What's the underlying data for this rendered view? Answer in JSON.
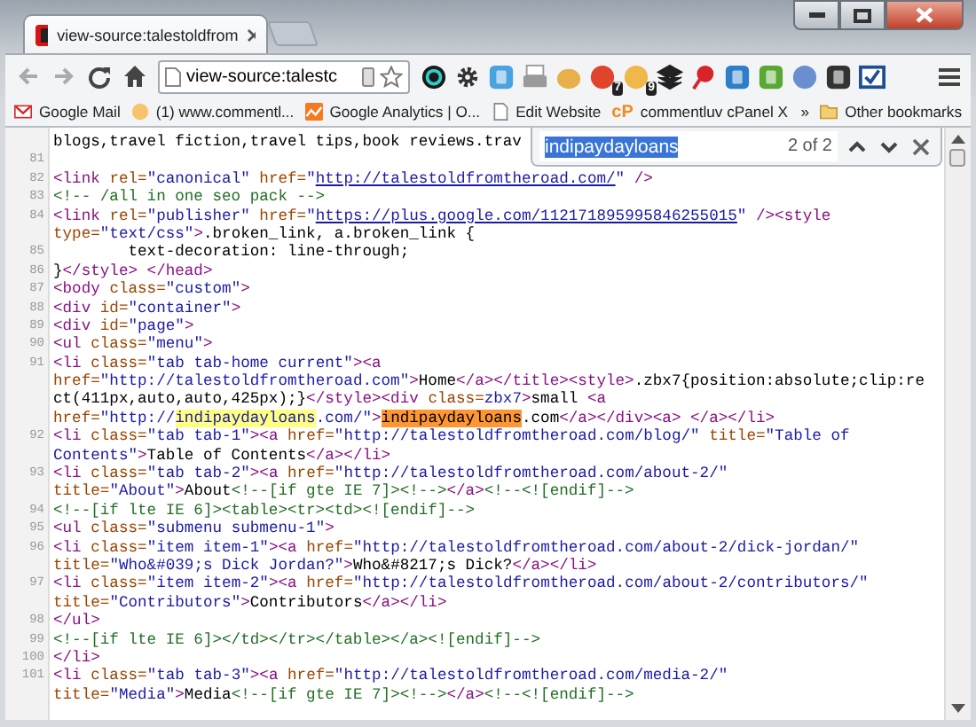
{
  "tabs": [
    {
      "title": "view-source:talestoldfrom",
      "selected": true
    }
  ],
  "toolbar": {
    "address": "view-source:talestc"
  },
  "extensions": [
    {
      "kind": "ring",
      "color": "#1a1a1a"
    },
    {
      "kind": "gear",
      "color": "#333333"
    },
    {
      "kind": "tile",
      "color": "#4aa3df"
    },
    {
      "kind": "printer",
      "color": "#9a9a9a"
    },
    {
      "kind": "blob",
      "color": "#e8b04a"
    },
    {
      "kind": "circle",
      "color": "#e0442c",
      "badge": "7"
    },
    {
      "kind": "circle",
      "color": "#f0b84a",
      "badge": "9"
    },
    {
      "kind": "layers",
      "color": "#222222"
    },
    {
      "kind": "pin",
      "color": "#d8232a"
    },
    {
      "kind": "tile",
      "color": "#2f7fc8"
    },
    {
      "kind": "tile",
      "color": "#5aa832"
    },
    {
      "kind": "circle",
      "color": "#6a8fd0"
    },
    {
      "kind": "tile",
      "color": "#333333"
    },
    {
      "kind": "check",
      "color": "#1d4f91"
    }
  ],
  "bookmarks": [
    {
      "kind": "mail",
      "label": "Google Mail"
    },
    {
      "kind": "face",
      "label": "(1) www.commentl..."
    },
    {
      "kind": "chart",
      "label": "Google Analytics | O..."
    },
    {
      "kind": "page",
      "label": "Edit Website"
    },
    {
      "kind": "logo",
      "logo_text": "cP",
      "label": "commentluv cPanel X"
    },
    {
      "kind": "more",
      "label": "»"
    },
    {
      "kind": "folder",
      "label": "Other bookmarks"
    }
  ],
  "find_bar": {
    "query": "indipaydayloans",
    "count": "2 of 2"
  },
  "source_lines": [
    {
      "tokens": [
        {
          "kind": "text",
          "text": "blogs,travel fiction,travel tips,book reviews.trav"
        }
      ]
    },
    {
      "number": "81"
    },
    {
      "number": "82",
      "tokens": [
        {
          "kind": "tag",
          "text": "<link "
        },
        {
          "kind": "attr",
          "text": "rel="
        },
        {
          "kind": "value",
          "text": "\"canonical\""
        },
        {
          "kind": "attr",
          "text": " href="
        },
        {
          "kind": "value",
          "text": "\""
        },
        {
          "kind": "link",
          "text": "http://talestoldfromtheroad.com/"
        },
        {
          "kind": "value",
          "text": "\""
        },
        {
          "kind": "tag",
          "text": " />"
        }
      ]
    },
    {
      "number": "83",
      "tokens": [
        {
          "kind": "comment",
          "text": "<!-- /all in one seo pack -->"
        }
      ]
    },
    {
      "number": "84",
      "tokens": [
        {
          "kind": "tag",
          "text": "<link "
        },
        {
          "kind": "attr",
          "text": "rel="
        },
        {
          "kind": "value",
          "text": "\"publisher\""
        },
        {
          "kind": "attr",
          "text": " href="
        },
        {
          "kind": "value",
          "text": "\""
        },
        {
          "kind": "link",
          "text": "https://plus.google.com/112171895995846255015"
        },
        {
          "kind": "value",
          "text": "\""
        },
        {
          "kind": "tag",
          "text": " /><style"
        },
        {
          "kind": "wrap"
        },
        {
          "kind": "attr",
          "text": "type="
        },
        {
          "kind": "value",
          "text": "\"text/css\""
        },
        {
          "kind": "tag",
          "text": ">"
        },
        {
          "kind": "text",
          "text": ".broken_link, a.broken_link {"
        }
      ]
    },
    {
      "number": "85",
      "tokens": [
        {
          "kind": "text",
          "text": "        text-decoration: line-through;"
        }
      ]
    },
    {
      "number": "86",
      "tokens": [
        {
          "kind": "text",
          "text": "}"
        },
        {
          "kind": "tag",
          "text": "</style> </head>"
        }
      ]
    },
    {
      "number": "87",
      "tokens": [
        {
          "kind": "tag",
          "text": "<body "
        },
        {
          "kind": "attr",
          "text": "class="
        },
        {
          "kind": "value",
          "text": "\"custom\""
        },
        {
          "kind": "tag",
          "text": ">"
        }
      ]
    },
    {
      "number": "88",
      "tokens": [
        {
          "kind": "tag",
          "text": "<div "
        },
        {
          "kind": "attr",
          "text": "id="
        },
        {
          "kind": "value",
          "text": "\"container\""
        },
        {
          "kind": "tag",
          "text": ">"
        }
      ]
    },
    {
      "number": "89",
      "tokens": [
        {
          "kind": "tag",
          "text": "<div "
        },
        {
          "kind": "attr",
          "text": "id="
        },
        {
          "kind": "value",
          "text": "\"page\""
        },
        {
          "kind": "tag",
          "text": ">"
        }
      ]
    },
    {
      "number": "90",
      "tokens": [
        {
          "kind": "tag",
          "text": "<ul "
        },
        {
          "kind": "attr",
          "text": "class="
        },
        {
          "kind": "value",
          "text": "\"menu\""
        },
        {
          "kind": "tag",
          "text": ">"
        }
      ]
    },
    {
      "number": "91",
      "tokens": [
        {
          "kind": "tag",
          "text": "<li "
        },
        {
          "kind": "attr",
          "text": "class="
        },
        {
          "kind": "value",
          "text": "\"tab tab-home current\""
        },
        {
          "kind": "tag",
          "text": "><a"
        },
        {
          "kind": "wrap"
        },
        {
          "kind": "attr",
          "text": "href="
        },
        {
          "kind": "value",
          "text": "\"http://talestoldfromtheroad.com\""
        },
        {
          "kind": "tag",
          "text": ">"
        },
        {
          "kind": "text",
          "text": "Home"
        },
        {
          "kind": "tag",
          "text": "</a></title><style>"
        },
        {
          "kind": "text",
          "text": ".zbx7{position:absolute;clip:re"
        },
        {
          "kind": "wrap"
        },
        {
          "kind": "text",
          "text": "ct(411px,auto,auto,425px);}"
        },
        {
          "kind": "tag",
          "text": "</style><div "
        },
        {
          "kind": "attr",
          "text": "class="
        },
        {
          "kind": "value",
          "text": "zbx7"
        },
        {
          "kind": "tag",
          "text": ">"
        },
        {
          "kind": "text",
          "text": "small "
        },
        {
          "kind": "tag",
          "text": "<a"
        },
        {
          "kind": "wrap"
        },
        {
          "kind": "attr",
          "text": "href="
        },
        {
          "kind": "value",
          "text": "\"http://"
        },
        {
          "kind": "match",
          "text": "indipaydayloans"
        },
        {
          "kind": "value",
          "text": ".com/\""
        },
        {
          "kind": "tag",
          "text": ">"
        },
        {
          "kind": "current_match",
          "text": "indipaydayloans"
        },
        {
          "kind": "text",
          "text": ".com"
        },
        {
          "kind": "tag",
          "text": "</a></div><a> </a></li>"
        }
      ]
    },
    {
      "number": "92",
      "tokens": [
        {
          "kind": "tag",
          "text": "<li "
        },
        {
          "kind": "attr",
          "text": "class="
        },
        {
          "kind": "value",
          "text": "\"tab tab-1\""
        },
        {
          "kind": "tag",
          "text": "><a "
        },
        {
          "kind": "attr",
          "text": "href="
        },
        {
          "kind": "value",
          "text": "\"http://talestoldfromtheroad.com/blog/\""
        },
        {
          "kind": "attr",
          "text": " title="
        },
        {
          "kind": "value",
          "text": "\"Table of"
        },
        {
          "kind": "wrap"
        },
        {
          "kind": "value",
          "text": "Contents\""
        },
        {
          "kind": "tag",
          "text": ">"
        },
        {
          "kind": "text",
          "text": "Table of Contents"
        },
        {
          "kind": "tag",
          "text": "</a></li>"
        }
      ]
    },
    {
      "number": "93",
      "tokens": [
        {
          "kind": "tag",
          "text": "<li "
        },
        {
          "kind": "attr",
          "text": "class="
        },
        {
          "kind": "value",
          "text": "\"tab tab-2\""
        },
        {
          "kind": "tag",
          "text": "><a "
        },
        {
          "kind": "attr",
          "text": "href="
        },
        {
          "kind": "value",
          "text": "\"http://talestoldfromtheroad.com/about-2/\""
        },
        {
          "kind": "wrap"
        },
        {
          "kind": "attr",
          "text": "title="
        },
        {
          "kind": "value",
          "text": "\"About\""
        },
        {
          "kind": "tag",
          "text": ">"
        },
        {
          "kind": "text",
          "text": "About"
        },
        {
          "kind": "comment",
          "text": "<!--[if gte IE 7]><!-->"
        },
        {
          "kind": "tag",
          "text": "</a>"
        },
        {
          "kind": "comment",
          "text": "<!--<![endif]-->"
        }
      ]
    },
    {
      "number": "94",
      "tokens": [
        {
          "kind": "comment",
          "text": "<!--[if lte IE 6]><table><tr><td><![endif]-->"
        }
      ]
    },
    {
      "number": "95",
      "tokens": [
        {
          "kind": "tag",
          "text": "<ul "
        },
        {
          "kind": "attr",
          "text": "class="
        },
        {
          "kind": "value",
          "text": "\"submenu submenu-1\""
        },
        {
          "kind": "tag",
          "text": ">"
        }
      ]
    },
    {
      "number": "96",
      "tokens": [
        {
          "kind": "tag",
          "text": "<li "
        },
        {
          "kind": "attr",
          "text": "class="
        },
        {
          "kind": "value",
          "text": "\"item item-1\""
        },
        {
          "kind": "tag",
          "text": "><a "
        },
        {
          "kind": "attr",
          "text": "href="
        },
        {
          "kind": "value",
          "text": "\"http://talestoldfromtheroad.com/about-2/dick-jordan/\""
        },
        {
          "kind": "wrap"
        },
        {
          "kind": "attr",
          "text": "title="
        },
        {
          "kind": "value",
          "text": "\"Who&#039;s Dick Jordan?\""
        },
        {
          "kind": "tag",
          "text": ">"
        },
        {
          "kind": "text",
          "text": "Who&#8217;s Dick?"
        },
        {
          "kind": "tag",
          "text": "</a></li>"
        }
      ]
    },
    {
      "number": "97",
      "tokens": [
        {
          "kind": "tag",
          "text": "<li "
        },
        {
          "kind": "attr",
          "text": "class="
        },
        {
          "kind": "value",
          "text": "\"item item-2\""
        },
        {
          "kind": "tag",
          "text": "><a "
        },
        {
          "kind": "attr",
          "text": "href="
        },
        {
          "kind": "value",
          "text": "\"http://talestoldfromtheroad.com/about-2/contributors/\""
        },
        {
          "kind": "wrap"
        },
        {
          "kind": "attr",
          "text": "title="
        },
        {
          "kind": "value",
          "text": "\"Contributors\""
        },
        {
          "kind": "tag",
          "text": ">"
        },
        {
          "kind": "text",
          "text": "Contributors"
        },
        {
          "kind": "tag",
          "text": "</a></li>"
        }
      ]
    },
    {
      "number": "98",
      "tokens": [
        {
          "kind": "tag",
          "text": "</ul>"
        }
      ]
    },
    {
      "number": "99",
      "tokens": [
        {
          "kind": "comment",
          "text": "<!--[if lte IE 6]></td></tr></table></a><![endif]-->"
        }
      ]
    },
    {
      "number": "100",
      "tokens": [
        {
          "kind": "tag",
          "text": "</li>"
        }
      ]
    },
    {
      "number": "101",
      "tokens": [
        {
          "kind": "tag",
          "text": "<li "
        },
        {
          "kind": "attr",
          "text": "class="
        },
        {
          "kind": "value",
          "text": "\"tab tab-3\""
        },
        {
          "kind": "tag",
          "text": "><a "
        },
        {
          "kind": "attr",
          "text": "href="
        },
        {
          "kind": "value",
          "text": "\"http://talestoldfromtheroad.com/media-2/\""
        },
        {
          "kind": "wrap"
        },
        {
          "kind": "attr",
          "text": "title="
        },
        {
          "kind": "value",
          "text": "\"Media\""
        },
        {
          "kind": "tag",
          "text": ">"
        },
        {
          "kind": "text",
          "text": "Media"
        },
        {
          "kind": "comment",
          "text": "<!--[if gte IE 7]><!-->"
        },
        {
          "kind": "tag",
          "text": "</a>"
        },
        {
          "kind": "comment",
          "text": "<!--<![endif]-->"
        }
      ]
    }
  ]
}
